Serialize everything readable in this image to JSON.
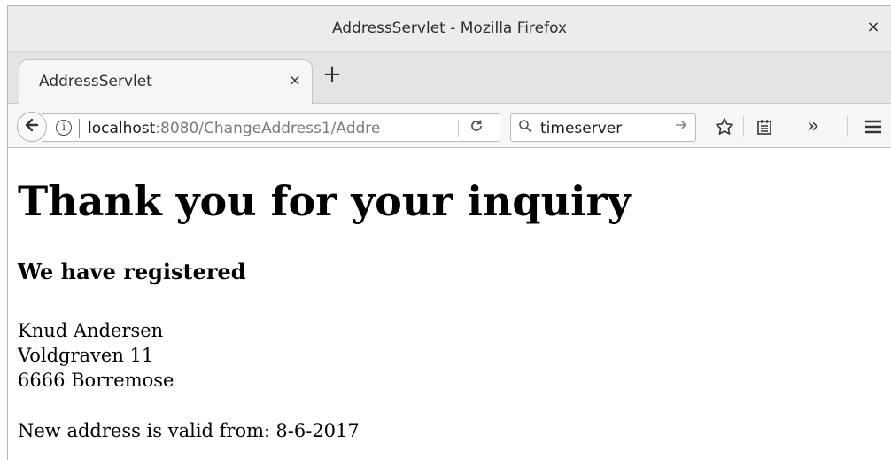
{
  "window": {
    "title": "AddressServlet - Mozilla Firefox",
    "close_glyph": "×"
  },
  "tabs": [
    {
      "label": "AddressServlet",
      "close_glyph": "×"
    }
  ],
  "new_tab_glyph": "+",
  "navbar": {
    "url_host": "localhost",
    "url_rest": ":8080/ChangeAddress1/Addre",
    "search_value": "timeserver",
    "overflow_glyph": "»"
  },
  "page": {
    "heading": "Thank you for your inquiry",
    "subheading": "We have registered",
    "address_lines": [
      "Knud Andersen",
      "Voldgraven 11",
      "6666 Borremose"
    ],
    "valid_label": "New address is valid from:",
    "valid_date": "8-6-2017"
  },
  "icons": {
    "back": "back-arrow-icon",
    "info": "info-icon",
    "reload": "reload-icon",
    "search": "search-icon",
    "go": "go-arrow-icon",
    "bookmark": "star-icon",
    "library": "library-icon",
    "menu": "hamburger-menu-icon"
  }
}
